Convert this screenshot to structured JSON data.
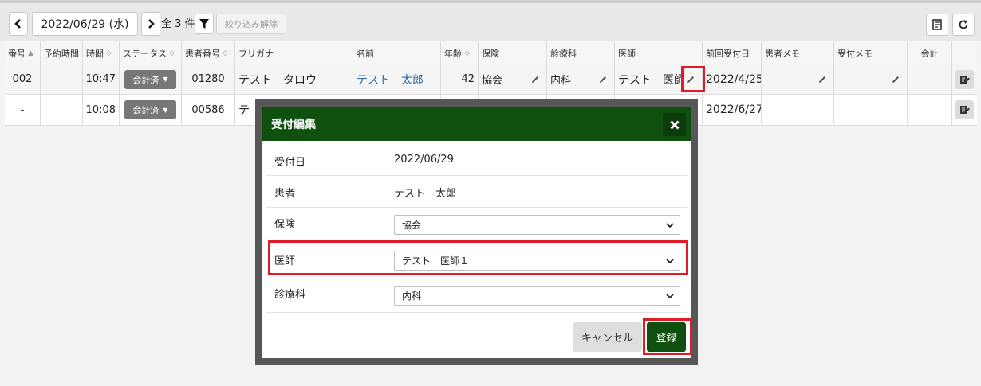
{
  "toolbar": {
    "date": "2022/06/29 (水)",
    "count_label": "全 3 件",
    "clear_filter_label": "絞り込み解除"
  },
  "table": {
    "headers": [
      "番号",
      "予約時間",
      "時間",
      "ステータス",
      "患者番号",
      "フリガナ",
      "名前",
      "年齢",
      "保険",
      "診療科",
      "医師",
      "前回受付日",
      "患者メモ",
      "受付メモ",
      "会計"
    ],
    "rows": [
      {
        "no": "002",
        "reserve_time": "",
        "time": "10:47",
        "status": "会計済",
        "patient_no": "01280",
        "furigana": "テスト　タロウ",
        "name": "テスト　太郎",
        "age": "42",
        "insurance": "協会",
        "department": "内科",
        "doctor": "テスト　医師",
        "last_visit": "2022/4/25",
        "patient_memo": "",
        "reception_memo": "",
        "billing": ""
      },
      {
        "no": "-",
        "reserve_time": "",
        "time": "10:08",
        "status": "会計済",
        "patient_no": "00586",
        "furigana": "テ",
        "name": "",
        "age": "",
        "insurance": "",
        "department": "",
        "doctor": "",
        "last_visit": "2022/6/27",
        "patient_memo": "",
        "reception_memo": "",
        "billing": ""
      }
    ]
  },
  "modal": {
    "title": "受付編集",
    "fields": {
      "date_label": "受付日",
      "date_value": "2022/06/29",
      "patient_label": "患者",
      "patient_value": "テスト　太郎",
      "insurance_label": "保険",
      "insurance_value": "協会",
      "doctor_label": "医師",
      "doctor_value": "テスト　医師１",
      "department_label": "診療科",
      "department_value": "内科"
    },
    "cancel_label": "キャンセル",
    "submit_label": "登録"
  },
  "icons": {
    "prev": "chevron-left-icon",
    "next": "chevron-right-icon",
    "filter": "filter-icon",
    "export": "document-icon",
    "refresh": "refresh-icon",
    "edit": "pencil-icon",
    "close": "close-icon",
    "action": "edit-document-icon"
  },
  "colors": {
    "header_green": "#10500f",
    "highlight_red": "#e11c2a",
    "status_gray": "#777777",
    "link_blue": "#2b6ea8"
  }
}
